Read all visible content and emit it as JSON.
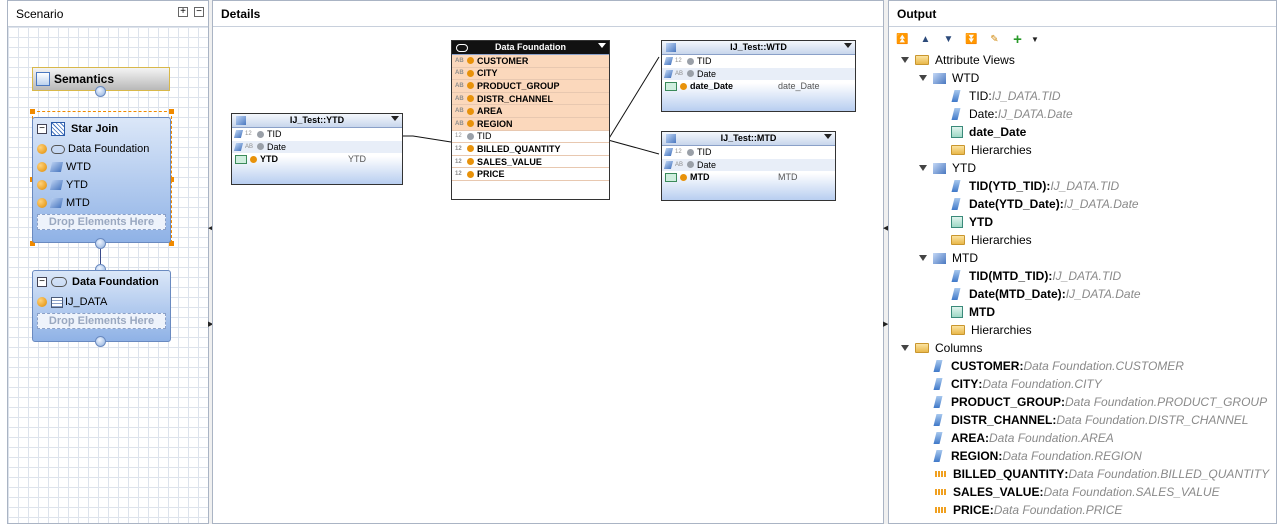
{
  "scenario": {
    "title": "Scenario",
    "semantics_label": "Semantics",
    "star_join": {
      "title": "Star Join",
      "items": [
        "Data Foundation",
        "WTD",
        "YTD",
        "MTD"
      ],
      "drop_label": "Drop Elements Here"
    },
    "data_foundation_node": {
      "title": "Data Foundation",
      "items": [
        "IJ_DATA"
      ],
      "drop_label": "Drop Elements Here"
    }
  },
  "details": {
    "title": "Details",
    "ytd_table": {
      "title": "IJ_Test::YTD",
      "rows": [
        {
          "type": "12",
          "name": "TID",
          "alias": ""
        },
        {
          "type": "AB",
          "name": "Date",
          "alias": ""
        },
        {
          "type": "",
          "name": "YTD",
          "alias": "YTD"
        }
      ]
    },
    "data_foundation_table": {
      "title": "Data Foundation",
      "rows": [
        {
          "type": "AB",
          "name": "CUSTOMER"
        },
        {
          "type": "AB",
          "name": "CITY"
        },
        {
          "type": "AB",
          "name": "PRODUCT_GROUP"
        },
        {
          "type": "AB",
          "name": "DISTR_CHANNEL"
        },
        {
          "type": "AB",
          "name": "AREA"
        },
        {
          "type": "AB",
          "name": "REGION"
        },
        {
          "type": "12",
          "name": "TID"
        },
        {
          "type": "12",
          "name": "BILLED_QUANTITY"
        },
        {
          "type": "12",
          "name": "SALES_VALUE"
        },
        {
          "type": "12",
          "name": "PRICE"
        }
      ]
    },
    "wtd_table": {
      "title": "IJ_Test::WTD",
      "rows": [
        {
          "type": "12",
          "name": "TID",
          "alias": ""
        },
        {
          "type": "AB",
          "name": "Date",
          "alias": ""
        },
        {
          "type": "AB",
          "name": "date_Date",
          "alias": "date_Date"
        }
      ]
    },
    "mtd_table": {
      "title": "IJ_Test::MTD",
      "rows": [
        {
          "type": "12",
          "name": "TID",
          "alias": ""
        },
        {
          "type": "AB",
          "name": "Date",
          "alias": ""
        },
        {
          "type": "AB",
          "name": "MTD",
          "alias": "MTD"
        }
      ]
    }
  },
  "output": {
    "title": "Output",
    "attribute_views_label": "Attribute Views",
    "views": [
      {
        "name": "WTD",
        "attrs": [
          {
            "label": "TID",
            "src": "IJ_DATA.TID",
            "bold": false
          },
          {
            "label": "Date",
            "src": "IJ_DATA.Date",
            "bold": false
          }
        ],
        "key": "date_Date",
        "hierarchies": "Hierarchies"
      },
      {
        "name": "YTD",
        "attrs": [
          {
            "label": "TID(YTD_TID)",
            "src": "IJ_DATA.TID",
            "bold": true
          },
          {
            "label": "Date(YTD_Date)",
            "src": "IJ_DATA.Date",
            "bold": true
          }
        ],
        "key": "YTD",
        "hierarchies": "Hierarchies"
      },
      {
        "name": "MTD",
        "attrs": [
          {
            "label": "TID(MTD_TID)",
            "src": "IJ_DATA.TID",
            "bold": true
          },
          {
            "label": "Date(MTD_Date)",
            "src": "IJ_DATA.Date",
            "bold": true
          }
        ],
        "key": "MTD",
        "hierarchies": "Hierarchies"
      }
    ],
    "columns_label": "Columns",
    "columns": [
      {
        "label": "CUSTOMER",
        "src": "Data Foundation.CUSTOMER",
        "kind": "attr"
      },
      {
        "label": "CITY",
        "src": "Data Foundation.CITY",
        "kind": "attr"
      },
      {
        "label": "PRODUCT_GROUP",
        "src": "Data Foundation.PRODUCT_GROUP",
        "kind": "attr"
      },
      {
        "label": "DISTR_CHANNEL",
        "src": "Data Foundation.DISTR_CHANNEL",
        "kind": "attr"
      },
      {
        "label": "AREA",
        "src": "Data Foundation.AREA",
        "kind": "attr"
      },
      {
        "label": "REGION",
        "src": "Data Foundation.REGION",
        "kind": "attr"
      },
      {
        "label": "BILLED_QUANTITY",
        "src": "Data Foundation.BILLED_QUANTITY",
        "kind": "measure"
      },
      {
        "label": "SALES_VALUE",
        "src": "Data Foundation.SALES_VALUE",
        "kind": "measure"
      },
      {
        "label": "PRICE",
        "src": "Data Foundation.PRICE",
        "kind": "measure"
      }
    ]
  }
}
